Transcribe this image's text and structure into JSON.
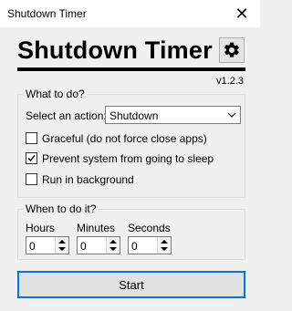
{
  "window": {
    "title": "Shutdown Timer",
    "close_glyph": "✕"
  },
  "header": {
    "app_name": "Shutdown Timer",
    "settings_icon": "gear-icon",
    "version": "v1.2.3"
  },
  "what_group": {
    "legend": "What to do?",
    "action_label": "Select an action:",
    "action_value": "Shutdown",
    "options": [
      {
        "label": "Graceful (do not force close apps)",
        "checked": false
      },
      {
        "label": "Prevent system from going to sleep",
        "checked": true
      },
      {
        "label": "Run in background",
        "checked": false
      }
    ]
  },
  "when_group": {
    "legend": "When to do it?",
    "hours_label": "Hours",
    "minutes_label": "Minutes",
    "seconds_label": "Seconds",
    "hours_value": "0",
    "minutes_value": "0",
    "seconds_value": "0"
  },
  "start_label": "Start",
  "colors": {
    "accent": "#0078d7"
  }
}
